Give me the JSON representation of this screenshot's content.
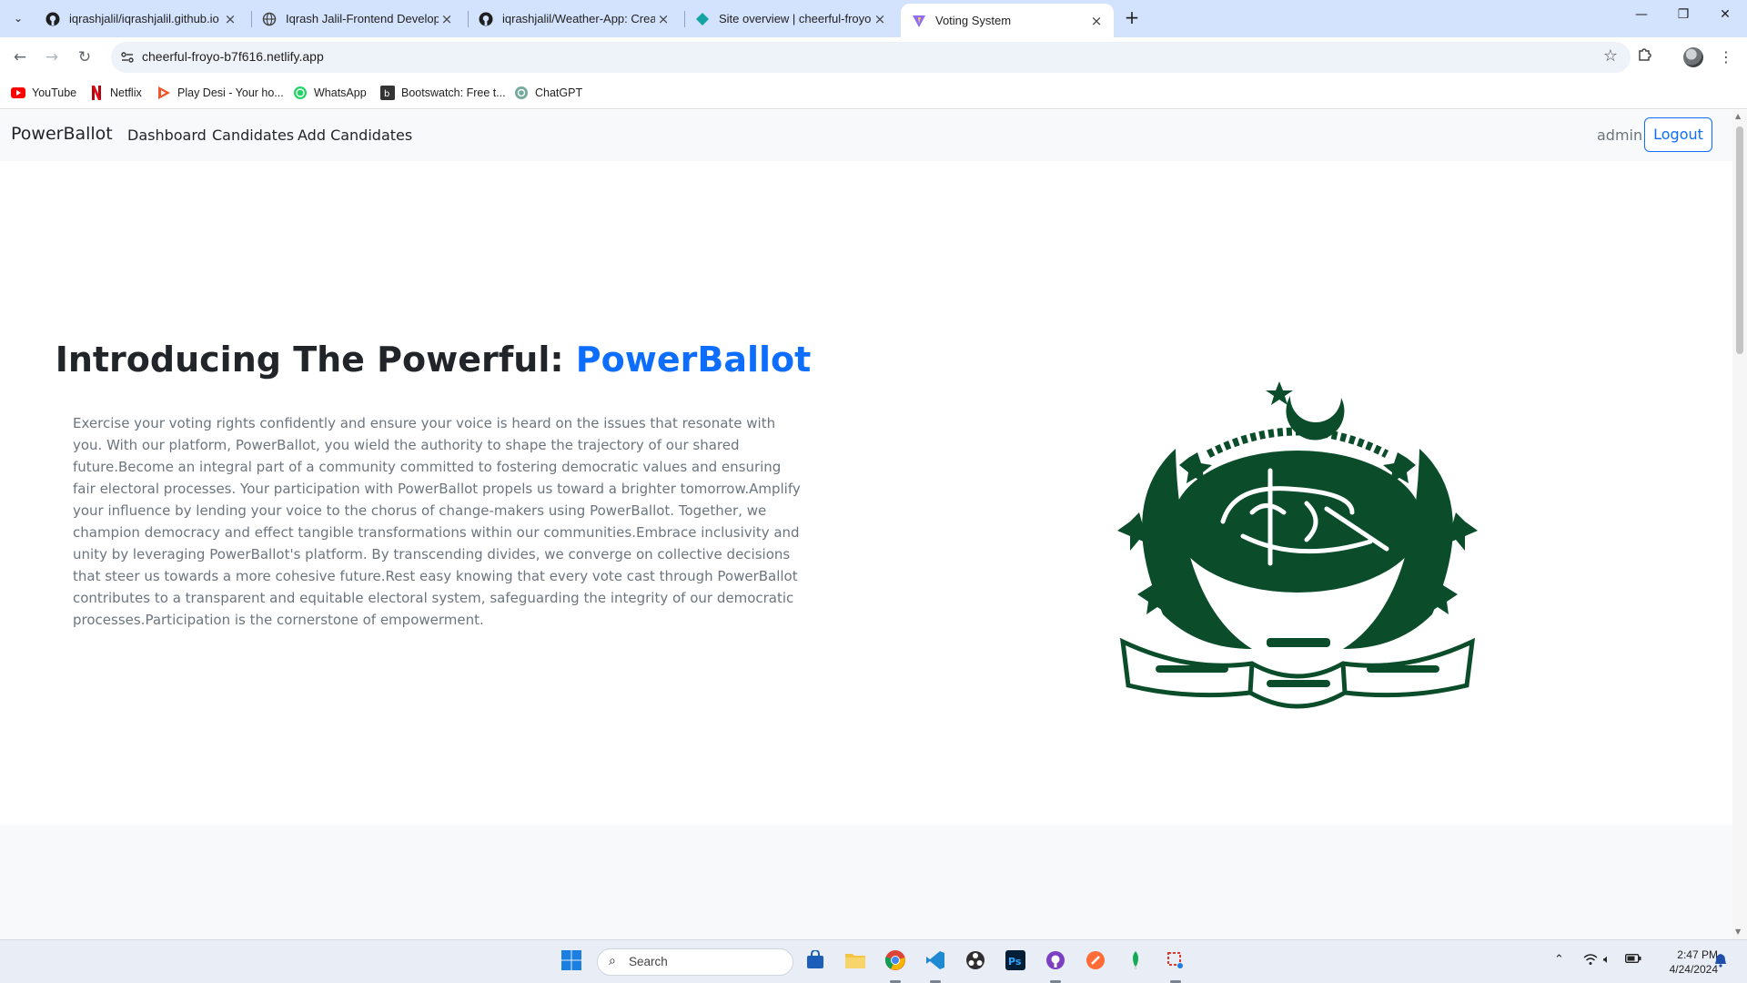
{
  "browser": {
    "tabs": [
      {
        "title": "iqrashjalil/iqrashjalil.github.io",
        "icon": "github-icon"
      },
      {
        "title": "Iqrash Jalil-Frontend Develope",
        "icon": "globe-icon"
      },
      {
        "title": "iqrashjalil/Weather-App: Creat",
        "icon": "github-icon"
      },
      {
        "title": "Site overview | cheerful-froyo-",
        "icon": "netlify-icon"
      },
      {
        "title": "Voting System",
        "icon": "vite-icon",
        "active": true
      }
    ],
    "url": "cheerful-froyo-b7f616.netlify.app",
    "bookmarks": [
      {
        "label": "YouTube",
        "icon": "youtube-icon"
      },
      {
        "label": "Netflix",
        "icon": "netflix-icon"
      },
      {
        "label": "Play Desi - Your ho...",
        "icon": "play-desi-icon"
      },
      {
        "label": "WhatsApp",
        "icon": "whatsapp-icon"
      },
      {
        "label": "Bootswatch: Free t...",
        "icon": "bootswatch-icon"
      },
      {
        "label": "ChatGPT",
        "icon": "chatgpt-icon"
      }
    ]
  },
  "page": {
    "navbar": {
      "brand": "PowerBallot",
      "links": [
        "Dashboard",
        "Candidates",
        "Add Candidates"
      ],
      "user": "admin",
      "logout": "Logout"
    },
    "hero": {
      "heading_prefix": "Introducing The Powerful: ",
      "heading_accent": "PowerBallot",
      "paragraph": "Exercise your voting rights confidently and ensure your voice is heard on the issues that resonate with you. With our platform, PowerBallot, you wield the authority to shape the trajectory of our shared future.Become an integral part of a community committed to fostering democratic values and ensuring fair electoral processes. Your participation with PowerBallot propels us toward a brighter tomorrow.Amplify your influence by lending your voice to the chorus of change-makers using PowerBallot. Together, we champion democracy and effect tangible transformations within our communities.Embrace inclusivity and unity by leveraging PowerBallot's platform. By transcending divides, we converge on collective decisions that steer us towards a more cohesive future.Rest easy knowing that every vote cast through PowerBallot contributes to a transparent and equitable electoral system, safeguarding the integrity of our democratic processes.Participation is the cornerstone of empowerment.",
      "emblem_icon": "election-commission-emblem",
      "emblem_color": "#0b4d2a"
    },
    "colors": {
      "primary": "#0d6efd",
      "navbar_bg": "#f8f9fa",
      "muted_text": "#6c757d"
    }
  },
  "taskbar": {
    "search_placeholder": "Search",
    "time": "2:47 PM",
    "date": "4/24/2024"
  }
}
